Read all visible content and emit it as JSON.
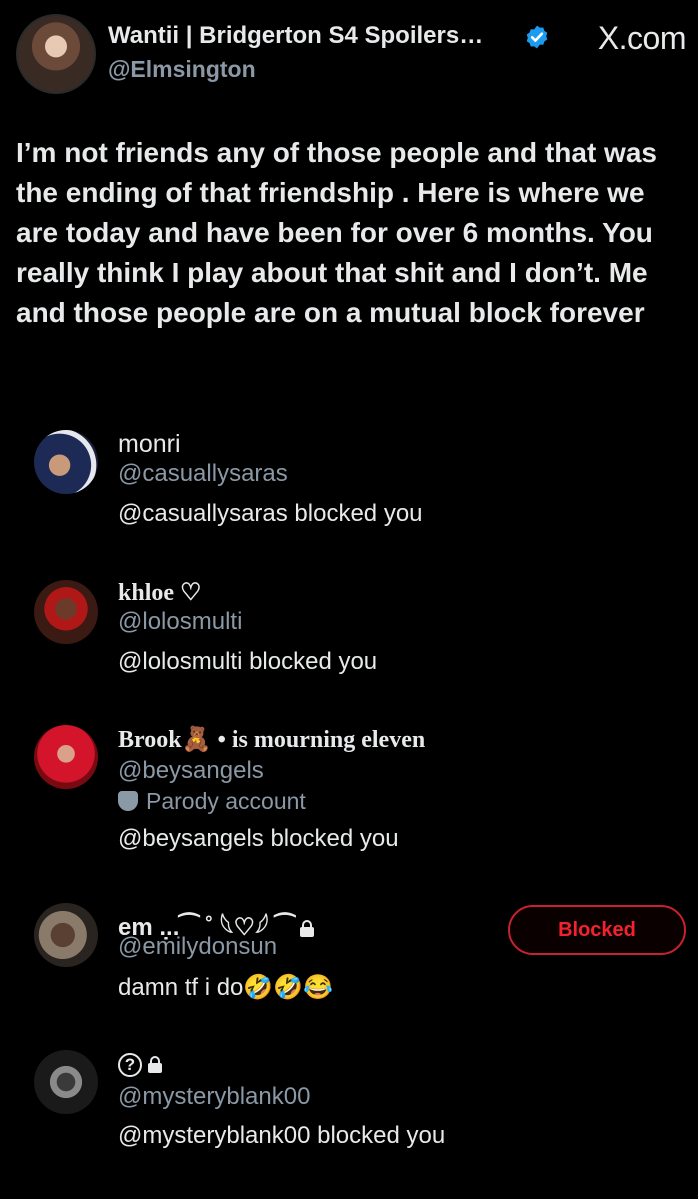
{
  "header": {
    "display_name": "Wantii | Bridgerton S4 Spoilers…",
    "handle": "@Elmsington",
    "brand": "X.com",
    "verified_icon": "verified-badge-icon"
  },
  "tweet": {
    "text": "I’m not friends any of those people and that was the ending of that friendship . Here is where we are today and have been for over 6 months. You really think I play about that shit and I don’t. Me and those people are on a mutual block forever"
  },
  "accounts": [
    {
      "name": "monri",
      "handle": "@casuallysaras",
      "status": "@casuallysaras blocked you"
    },
    {
      "name": "khloe ♡",
      "handle": "@lolosmulti",
      "status": "@lolosmulti blocked you"
    },
    {
      "name": "Brook🧸 • is mourning eleven",
      "handle": "@beysangels",
      "badge": "Parody account",
      "status": "@beysangels blocked you"
    },
    {
      "name": "em .̣..⁀ ˚ 𓆩♡𓆪 ⁀",
      "handle": "@emilydonsun",
      "status": "damn tf i do🤣🤣😂",
      "button": "Blocked"
    },
    {
      "name": "?",
      "handle": "@mysteryblank00",
      "status": "@mysteryblank00 blocked you"
    }
  ],
  "colors": {
    "background": "#000000",
    "text": "#e7e9ea",
    "secondary": "#8b98a5",
    "verified": "#1d9bf0",
    "blocked_red": "#f4212e"
  }
}
